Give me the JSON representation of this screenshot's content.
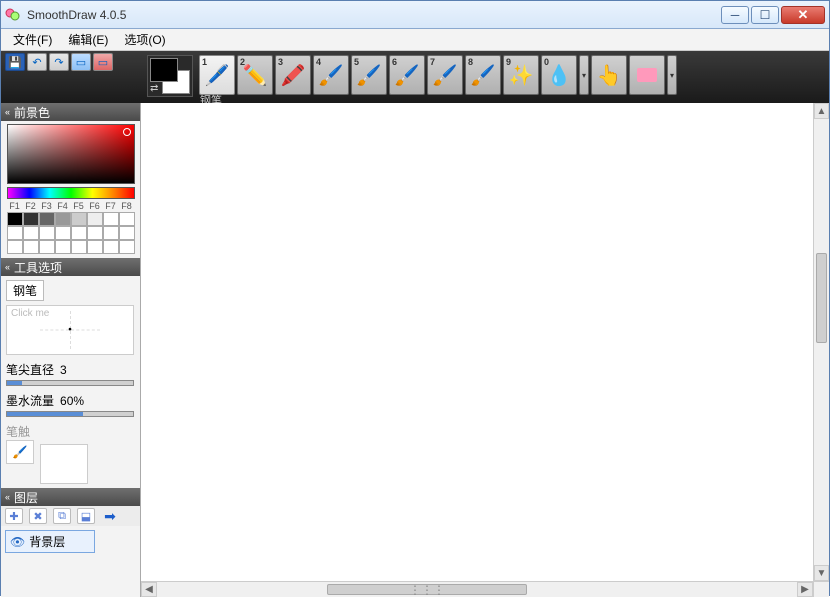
{
  "window": {
    "title": "SmoothDraw 4.0.5"
  },
  "menu": {
    "file": "文件(F)",
    "edit": "编辑(E)",
    "options": "选项(O)"
  },
  "toolbar": {
    "current_tool_label": "钢笔",
    "brushes": [
      {
        "num": "1",
        "icon": "pen"
      },
      {
        "num": "2",
        "icon": "pencil"
      },
      {
        "num": "3",
        "icon": "marker"
      },
      {
        "num": "4",
        "icon": "brush1"
      },
      {
        "num": "5",
        "icon": "brush2"
      },
      {
        "num": "6",
        "icon": "brush3"
      },
      {
        "num": "7",
        "icon": "brush4"
      },
      {
        "num": "8",
        "icon": "brush5"
      },
      {
        "num": "9",
        "icon": "star"
      },
      {
        "num": "0",
        "icon": "drop"
      },
      {
        "num": "",
        "icon": "smudge"
      },
      {
        "num": "",
        "icon": "eraser"
      }
    ]
  },
  "panels": {
    "foreground_color": "前景色",
    "tool_options": "工具选项",
    "layers": "图层"
  },
  "color": {
    "flabels": [
      "F1",
      "F2",
      "F3",
      "F4",
      "F5",
      "F6",
      "F7",
      "F8"
    ]
  },
  "tool_options": {
    "tool_name": "钢笔",
    "click_me": "Click me",
    "tip_diameter_label": "笔尖直径",
    "tip_diameter_value": "3",
    "ink_flow_label": "墨水流量",
    "ink_flow_value": "60%",
    "texture_label": "笔触"
  },
  "layers": {
    "items": [
      {
        "name": "背景层"
      }
    ]
  },
  "scroll": {
    "grip": "⋮⋮⋮"
  }
}
